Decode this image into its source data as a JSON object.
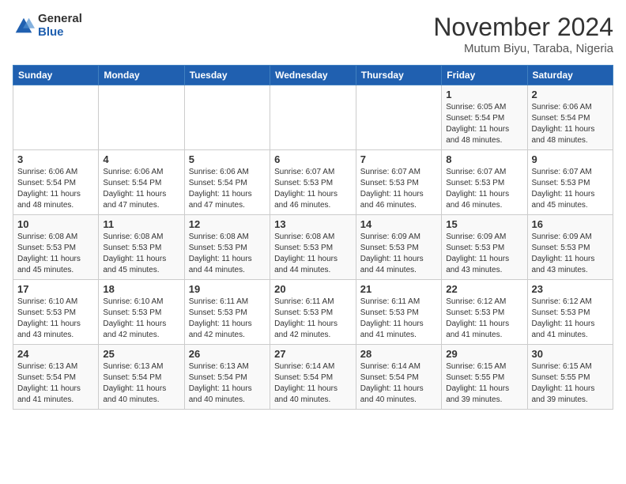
{
  "logo": {
    "general": "General",
    "blue": "Blue"
  },
  "title": "November 2024",
  "location": "Mutum Biyu, Taraba, Nigeria",
  "headers": [
    "Sunday",
    "Monday",
    "Tuesday",
    "Wednesday",
    "Thursday",
    "Friday",
    "Saturday"
  ],
  "weeks": [
    [
      {
        "day": "",
        "info": ""
      },
      {
        "day": "",
        "info": ""
      },
      {
        "day": "",
        "info": ""
      },
      {
        "day": "",
        "info": ""
      },
      {
        "day": "",
        "info": ""
      },
      {
        "day": "1",
        "info": "Sunrise: 6:05 AM\nSunset: 5:54 PM\nDaylight: 11 hours\nand 48 minutes."
      },
      {
        "day": "2",
        "info": "Sunrise: 6:06 AM\nSunset: 5:54 PM\nDaylight: 11 hours\nand 48 minutes."
      }
    ],
    [
      {
        "day": "3",
        "info": "Sunrise: 6:06 AM\nSunset: 5:54 PM\nDaylight: 11 hours\nand 48 minutes."
      },
      {
        "day": "4",
        "info": "Sunrise: 6:06 AM\nSunset: 5:54 PM\nDaylight: 11 hours\nand 47 minutes."
      },
      {
        "day": "5",
        "info": "Sunrise: 6:06 AM\nSunset: 5:54 PM\nDaylight: 11 hours\nand 47 minutes."
      },
      {
        "day": "6",
        "info": "Sunrise: 6:07 AM\nSunset: 5:53 PM\nDaylight: 11 hours\nand 46 minutes."
      },
      {
        "day": "7",
        "info": "Sunrise: 6:07 AM\nSunset: 5:53 PM\nDaylight: 11 hours\nand 46 minutes."
      },
      {
        "day": "8",
        "info": "Sunrise: 6:07 AM\nSunset: 5:53 PM\nDaylight: 11 hours\nand 46 minutes."
      },
      {
        "day": "9",
        "info": "Sunrise: 6:07 AM\nSunset: 5:53 PM\nDaylight: 11 hours\nand 45 minutes."
      }
    ],
    [
      {
        "day": "10",
        "info": "Sunrise: 6:08 AM\nSunset: 5:53 PM\nDaylight: 11 hours\nand 45 minutes."
      },
      {
        "day": "11",
        "info": "Sunrise: 6:08 AM\nSunset: 5:53 PM\nDaylight: 11 hours\nand 45 minutes."
      },
      {
        "day": "12",
        "info": "Sunrise: 6:08 AM\nSunset: 5:53 PM\nDaylight: 11 hours\nand 44 minutes."
      },
      {
        "day": "13",
        "info": "Sunrise: 6:08 AM\nSunset: 5:53 PM\nDaylight: 11 hours\nand 44 minutes."
      },
      {
        "day": "14",
        "info": "Sunrise: 6:09 AM\nSunset: 5:53 PM\nDaylight: 11 hours\nand 44 minutes."
      },
      {
        "day": "15",
        "info": "Sunrise: 6:09 AM\nSunset: 5:53 PM\nDaylight: 11 hours\nand 43 minutes."
      },
      {
        "day": "16",
        "info": "Sunrise: 6:09 AM\nSunset: 5:53 PM\nDaylight: 11 hours\nand 43 minutes."
      }
    ],
    [
      {
        "day": "17",
        "info": "Sunrise: 6:10 AM\nSunset: 5:53 PM\nDaylight: 11 hours\nand 43 minutes."
      },
      {
        "day": "18",
        "info": "Sunrise: 6:10 AM\nSunset: 5:53 PM\nDaylight: 11 hours\nand 42 minutes."
      },
      {
        "day": "19",
        "info": "Sunrise: 6:11 AM\nSunset: 5:53 PM\nDaylight: 11 hours\nand 42 minutes."
      },
      {
        "day": "20",
        "info": "Sunrise: 6:11 AM\nSunset: 5:53 PM\nDaylight: 11 hours\nand 42 minutes."
      },
      {
        "day": "21",
        "info": "Sunrise: 6:11 AM\nSunset: 5:53 PM\nDaylight: 11 hours\nand 41 minutes."
      },
      {
        "day": "22",
        "info": "Sunrise: 6:12 AM\nSunset: 5:53 PM\nDaylight: 11 hours\nand 41 minutes."
      },
      {
        "day": "23",
        "info": "Sunrise: 6:12 AM\nSunset: 5:53 PM\nDaylight: 11 hours\nand 41 minutes."
      }
    ],
    [
      {
        "day": "24",
        "info": "Sunrise: 6:13 AM\nSunset: 5:54 PM\nDaylight: 11 hours\nand 41 minutes."
      },
      {
        "day": "25",
        "info": "Sunrise: 6:13 AM\nSunset: 5:54 PM\nDaylight: 11 hours\nand 40 minutes."
      },
      {
        "day": "26",
        "info": "Sunrise: 6:13 AM\nSunset: 5:54 PM\nDaylight: 11 hours\nand 40 minutes."
      },
      {
        "day": "27",
        "info": "Sunrise: 6:14 AM\nSunset: 5:54 PM\nDaylight: 11 hours\nand 40 minutes."
      },
      {
        "day": "28",
        "info": "Sunrise: 6:14 AM\nSunset: 5:54 PM\nDaylight: 11 hours\nand 40 minutes."
      },
      {
        "day": "29",
        "info": "Sunrise: 6:15 AM\nSunset: 5:55 PM\nDaylight: 11 hours\nand 39 minutes."
      },
      {
        "day": "30",
        "info": "Sunrise: 6:15 AM\nSunset: 5:55 PM\nDaylight: 11 hours\nand 39 minutes."
      }
    ]
  ]
}
